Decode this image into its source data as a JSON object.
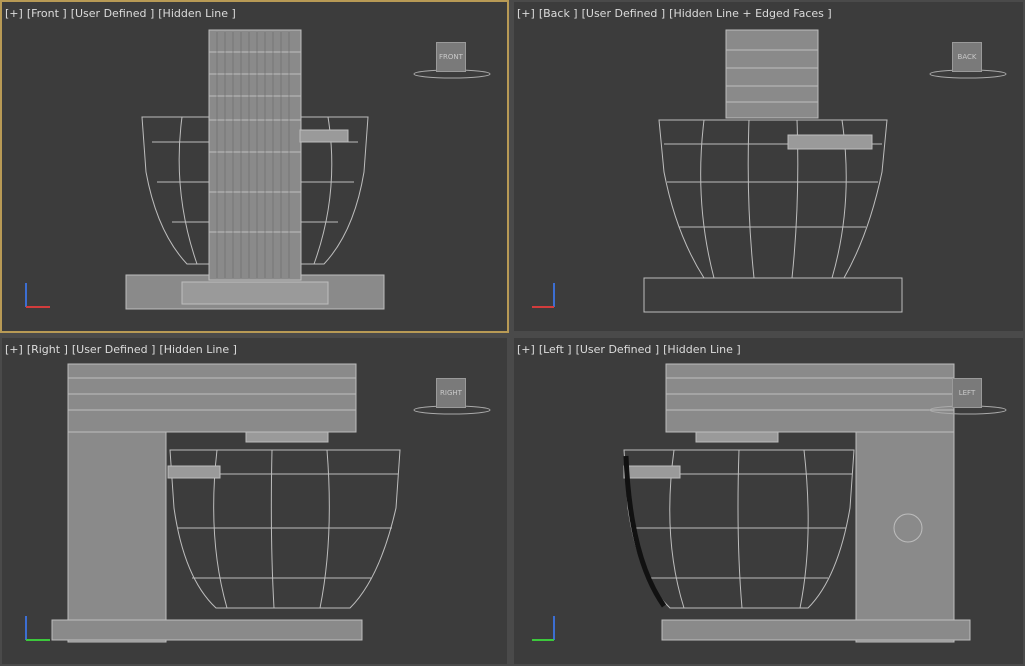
{
  "viewports": [
    {
      "id": "front",
      "label_parts": [
        "[+]",
        "[Front ]",
        "[User Defined ]",
        "[Hidden Line ]"
      ],
      "cube_label": "FRONT",
      "active": true
    },
    {
      "id": "back",
      "label_parts": [
        "[+]",
        "[Back ]",
        "[User Defined ]",
        "[Hidden Line + Edged Faces ]"
      ],
      "cube_label": "BACK",
      "active": false
    },
    {
      "id": "right",
      "label_parts": [
        "[+]",
        "[Right ]",
        "[User Defined ]",
        "[Hidden Line ]"
      ],
      "cube_label": "RIGHT",
      "active": false
    },
    {
      "id": "left",
      "label_parts": [
        "[+]",
        "[Left ]",
        "[User Defined ]",
        "[Hidden Line ]"
      ],
      "cube_label": "LEFT",
      "active": false
    }
  ],
  "colors": {
    "viewport_bg": "#3c3c3c",
    "active_border": "#b89a55",
    "mesh": "#bdbdbd",
    "axis_x": "#d23c3c",
    "axis_y": "#3cc83c",
    "axis_z": "#3c6ed2"
  }
}
